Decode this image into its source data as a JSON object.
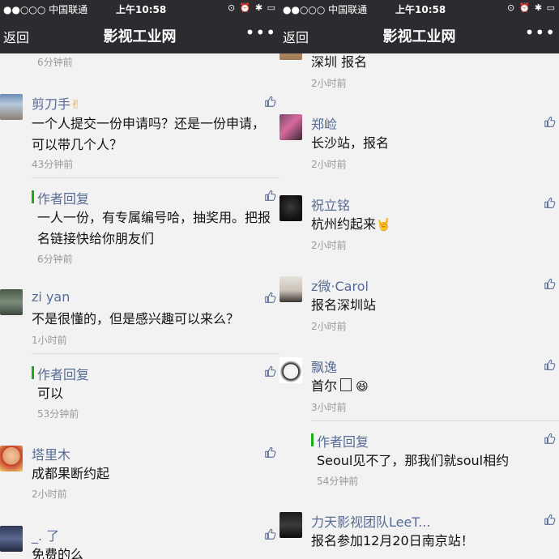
{
  "status": {
    "carrier": "●●○○○ 中国联通",
    "time": "上午10:58",
    "icons": "⊙ ⏰ ✱ ▭"
  },
  "nav": {
    "back": "返回",
    "title": "影视工业网",
    "more": "•••"
  },
  "left": {
    "top_time": "6分钟前",
    "c1": {
      "name": "剪刀手",
      "name_emoji": "✌",
      "text": "一个人提交一份申请吗？还是一份申请，可以带几个人？",
      "time": "43分钟前"
    },
    "r1": {
      "label": "作者回复",
      "text": "一人一份，有专属编号哈，抽奖用。把报名链接快给你朋友们",
      "time": "6分钟前"
    },
    "c2": {
      "name": "zi yan",
      "text": "不是很懂的，但是感兴趣可以来么？",
      "time": "1小时前"
    },
    "r2": {
      "label": "作者回复",
      "text": "可以",
      "time": "53分钟前"
    },
    "c3": {
      "name": "塔里木",
      "text": "成都果断约起",
      "time": "2小时前"
    },
    "c4": {
      "name": "_.    了",
      "text": "免费的么"
    }
  },
  "right": {
    "c0": {
      "text": "深圳 报名",
      "time": "2小时前"
    },
    "c1": {
      "name": "郑崄",
      "text": "长沙站，报名",
      "time": "2小时前"
    },
    "c2": {
      "name": "祝立铭",
      "text": "杭州约起来",
      "text_emoji": "🤘",
      "time": "2小时前"
    },
    "c3": {
      "name": "z微·Carol",
      "text": "报名深圳站",
      "time": "2小时前"
    },
    "c4": {
      "name": "飘逸",
      "text": "首尔",
      "text_emoji": "😆",
      "time": "3小时前"
    },
    "r1": {
      "label": "作者回复",
      "text": "Seoul见不了，那我们就soul相约",
      "time": "54分钟前"
    },
    "c5": {
      "name": "力天影视团队LeeT...",
      "text": "报名参加12月20日南京站！"
    }
  },
  "colors": {
    "bar": "#2c2c30",
    "name": "#576b95",
    "reply_bar": "#1aad19",
    "background": "#f2f2f2"
  }
}
